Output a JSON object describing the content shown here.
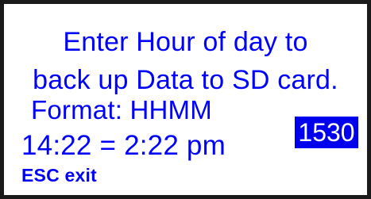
{
  "prompt": {
    "line1": "Enter Hour of day to",
    "line2": "back up Data to SD card.",
    "format_line": "Format: HHMM",
    "example_line": "14:22 = 2:22 pm",
    "escape_hint": "ESC exit"
  },
  "entry": {
    "value": "1530"
  },
  "colors": {
    "text": "#0000ff",
    "screen_background": "#ffffff",
    "frame": "#1a1a1a",
    "entry_background": "#0000ee",
    "entry_text": "#ffffff"
  }
}
